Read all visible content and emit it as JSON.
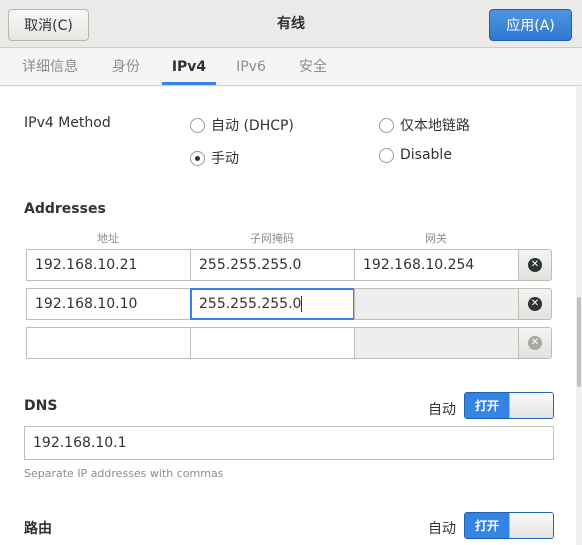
{
  "header": {
    "cancel_label": "取消(C)",
    "title": "有线",
    "apply_label": "应用(A)"
  },
  "tabs": [
    {
      "label": "详细信息"
    },
    {
      "label": "身份"
    },
    {
      "label": "IPv4"
    },
    {
      "label": "IPv6"
    },
    {
      "label": "安全"
    }
  ],
  "active_tab": "IPv4",
  "ipv4": {
    "method_label": "IPv4 Method",
    "methods": [
      {
        "label": "自动 (DHCP)",
        "checked": false
      },
      {
        "label": "仅本地链路",
        "checked": false
      },
      {
        "label": "手动",
        "checked": true
      },
      {
        "label": "Disable",
        "checked": false
      }
    ]
  },
  "addresses": {
    "section_label": "Addresses",
    "col_address": "地址",
    "col_netmask": "子网掩码",
    "col_gateway": "网关",
    "rows": [
      {
        "address": "192.168.10.21",
        "netmask": "255.255.255.0",
        "gateway": "192.168.10.254"
      },
      {
        "address": "192.168.10.10",
        "netmask": "255.255.255.0",
        "gateway": ""
      },
      {
        "address": "",
        "netmask": "",
        "gateway": ""
      }
    ]
  },
  "dns": {
    "label": "DNS",
    "auto_label": "自动",
    "switch_label": "打开",
    "value": "192.168.10.1",
    "hint": "Separate IP addresses with commas"
  },
  "routes": {
    "label": "路由",
    "auto_label": "自动",
    "switch_label": "打开"
  },
  "colors": {
    "accent": "#3584e4",
    "header_bg": "#ebeae8"
  }
}
